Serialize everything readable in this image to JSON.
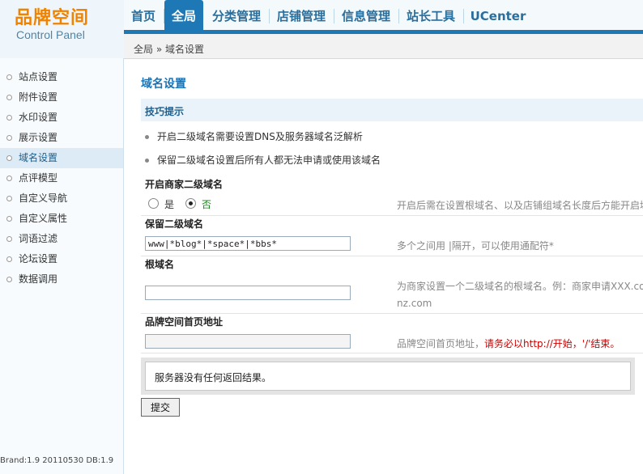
{
  "logo": {
    "title": "品牌空间",
    "subtitle": "Control Panel"
  },
  "nav": {
    "items": [
      {
        "label": "首页",
        "active": false
      },
      {
        "label": "全局",
        "active": true
      },
      {
        "label": "分类管理",
        "active": false
      },
      {
        "label": "店铺管理",
        "active": false
      },
      {
        "label": "信息管理",
        "active": false
      },
      {
        "label": "站长工具",
        "active": false
      },
      {
        "label": "UCenter",
        "active": false
      }
    ]
  },
  "breadcrumb": "全局 » 域名设置",
  "sidebar": {
    "items": [
      {
        "label": "站点设置",
        "active": false
      },
      {
        "label": "附件设置",
        "active": false
      },
      {
        "label": "水印设置",
        "active": false
      },
      {
        "label": "展示设置",
        "active": false
      },
      {
        "label": "域名设置",
        "active": true
      },
      {
        "label": "点评模型",
        "active": false
      },
      {
        "label": "自定义导航",
        "active": false
      },
      {
        "label": "自定义属性",
        "active": false
      },
      {
        "label": "词语过滤",
        "active": false
      },
      {
        "label": "论坛设置",
        "active": false
      },
      {
        "label": "数据调用",
        "active": false
      }
    ],
    "footer": "Brand:1.9 20110530 DB:1.9"
  },
  "main": {
    "title": "域名设置",
    "tips": {
      "heading": "技巧提示",
      "lines": [
        "开启二级域名需要设置DNS及服务器域名泛解析",
        "保留二级域名设置后所有人都无法申请或使用该域名"
      ]
    },
    "fields": {
      "enable_subdomain": {
        "label": "开启商家二级域名",
        "options": [
          "是",
          "否"
        ],
        "selected": "否",
        "hint": "开启后需在设置根域名、以及店铺组域名长度后方能开启域"
      },
      "reserved": {
        "label": "保留二级域名",
        "value": "www|*blog*|*space*|*bbs*",
        "hint": "多个之间用 |隔开，可以使用通配符*"
      },
      "root_domain": {
        "label": "根域名",
        "value": "",
        "hint_line1": "为商家设置一个二级域名的根域名。例：商家申请XXX.co",
        "hint_line2": "nz.com"
      },
      "homepage": {
        "label": "品牌空间首页地址",
        "value": "",
        "hint_plain": "品牌空间首页地址，",
        "hint_warn": "请务必以http://开始，'/'结束。"
      }
    },
    "message": "服务器没有任何返回结果。",
    "submit_label": "提交"
  },
  "colors": {
    "accent": "#1e78b5",
    "logo": "#f08200",
    "warn": "#cc0000"
  }
}
